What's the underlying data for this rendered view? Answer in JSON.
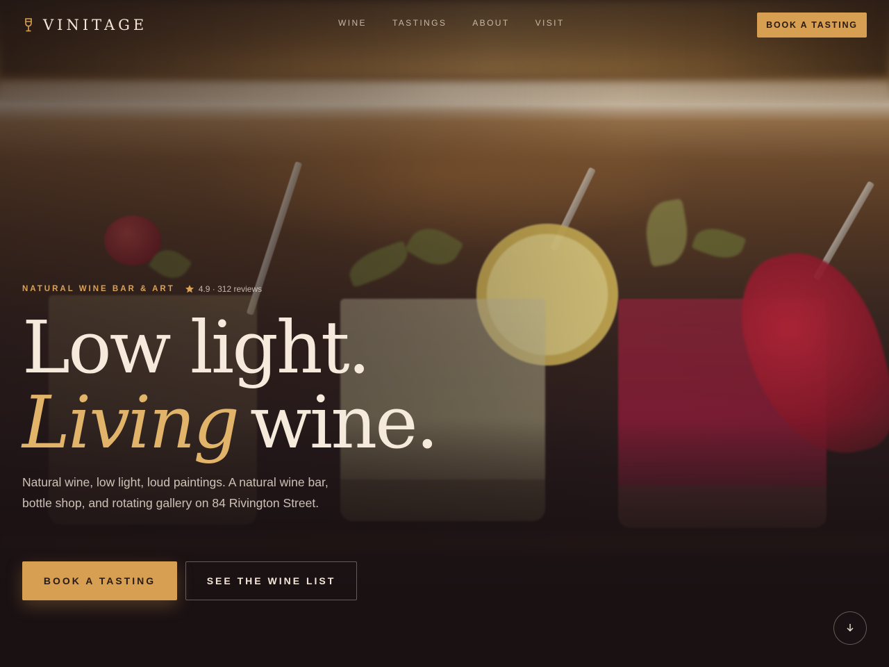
{
  "brand": {
    "name": "VINITAGE",
    "logo_icon": "wine-glass-icon"
  },
  "nav": {
    "items": [
      {
        "label": "WINE"
      },
      {
        "label": "TASTINGS"
      },
      {
        "label": "ABOUT"
      },
      {
        "label": "VISIT"
      }
    ],
    "cta_label": "BOOK A TASTING"
  },
  "hero": {
    "eyebrow": "NATURAL WINE BAR & ART",
    "rating": {
      "icon": "star-icon",
      "text": "4.9 · 312 reviews"
    },
    "headline": {
      "line1": "Low light.",
      "line2_accent": "Living",
      "line2_rest": "wine."
    },
    "lede": "Natural wine, low light, loud paintings. A natural wine bar, bottle shop, and rotating gallery on 84 Rivington Street.",
    "primary_cta": "BOOK A TASTING",
    "secondary_cta": "SEE THE WINE LIST",
    "scroll_icon": "arrow-down-icon"
  },
  "colors": {
    "background": "#1a1113",
    "accent": "#d69f52",
    "accent_text": "#e1b46a",
    "text": "#f3e6d8"
  }
}
